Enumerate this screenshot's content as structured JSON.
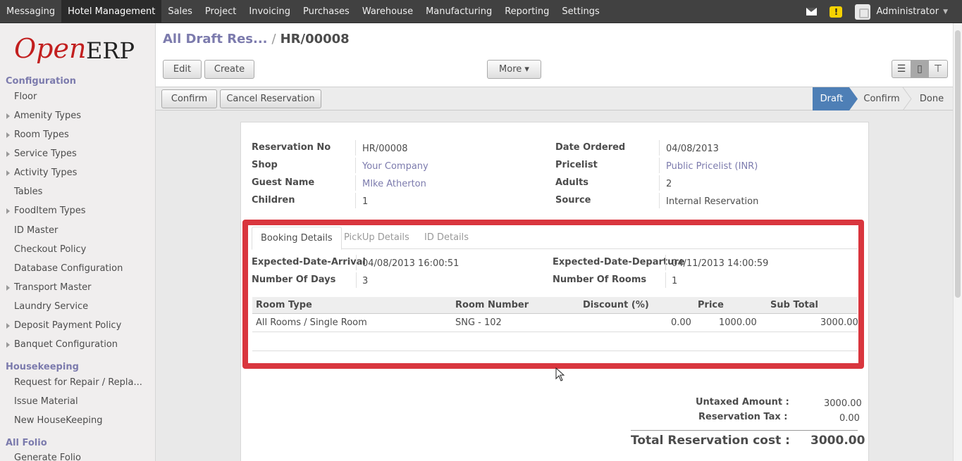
{
  "topbar": {
    "menu": [
      "Messaging",
      "Hotel Management",
      "Sales",
      "Project",
      "Invoicing",
      "Purchases",
      "Warehouse",
      "Manufacturing",
      "Reporting",
      "Settings"
    ],
    "active_menu": "Hotel Management",
    "user": "Administrator",
    "alert_glyph": "!"
  },
  "logo": {
    "open": "Open",
    "erp": "ERP"
  },
  "sidebar": {
    "sections": [
      {
        "title": "Configuration",
        "items": [
          {
            "label": "Floor",
            "expand": false
          },
          {
            "label": "Amenity Types",
            "expand": true
          },
          {
            "label": "Room Types",
            "expand": true
          },
          {
            "label": "Service Types",
            "expand": true
          },
          {
            "label": "Activity Types",
            "expand": true
          },
          {
            "label": "Tables",
            "expand": false
          },
          {
            "label": "FoodItem Types",
            "expand": true
          },
          {
            "label": "ID Master",
            "expand": false
          },
          {
            "label": "Checkout Policy",
            "expand": false
          },
          {
            "label": "Database Configuration",
            "expand": false
          },
          {
            "label": "Transport Master",
            "expand": true
          },
          {
            "label": "Laundry Service",
            "expand": false
          },
          {
            "label": "Deposit Payment Policy",
            "expand": true
          },
          {
            "label": "Banquet Configuration",
            "expand": true
          }
        ]
      },
      {
        "title": "Housekeeping",
        "items": [
          {
            "label": "Request for Repair / Repla...",
            "expand": false
          },
          {
            "label": "Issue Material",
            "expand": false
          },
          {
            "label": "New HouseKeeping",
            "expand": false
          }
        ]
      },
      {
        "title": "All Folio",
        "items": [
          {
            "label": "Generate Folio",
            "expand": false
          }
        ]
      }
    ]
  },
  "breadcrumb": {
    "parent": "All Draft Res...",
    "separator": "/",
    "current": "HR/00008"
  },
  "toolbar": {
    "edit": "Edit",
    "create": "Create",
    "more": "More ▾"
  },
  "view_icons": [
    "list-view-icon",
    "form-view-icon",
    "calendar-view-icon"
  ],
  "statusbar": {
    "confirm": "Confirm",
    "cancel": "Cancel Reservation",
    "stages": [
      "Draft",
      "Confirm",
      "Done"
    ],
    "active_stage": "Draft"
  },
  "form": {
    "reservation_no_label": "Reservation No",
    "reservation_no": "HR/00008",
    "shop_label": "Shop",
    "shop": "Your Company",
    "guest_label": "Guest Name",
    "guest": "MIke Atherton",
    "children_label": "Children",
    "children": "1",
    "date_ordered_label": "Date Ordered",
    "date_ordered": "04/08/2013",
    "pricelist_label": "Pricelist",
    "pricelist": "Public Pricelist (INR)",
    "adults_label": "Adults",
    "adults": "2",
    "source_label": "Source",
    "source": "Internal Reservation"
  },
  "tabs": [
    "Booking Details",
    "PickUp Details",
    "ID Details"
  ],
  "booking": {
    "arrival_label": "Expected-Date-Arrival",
    "arrival": "04/08/2013 16:00:51",
    "days_label": "Number Of Days",
    "days": "3",
    "departure_label": "Expected-Date-Departure",
    "departure": "04/11/2013 14:00:59",
    "rooms_label": "Number Of Rooms",
    "rooms": "1"
  },
  "grid": {
    "headers": [
      "Room Type",
      "Room Number",
      "Discount (%)",
      "Price",
      "Sub Total"
    ],
    "rows": [
      [
        "All Rooms / Single Room",
        "SNG - 102",
        "0.00",
        "1000.00",
        "3000.00"
      ]
    ]
  },
  "totals": {
    "untaxed_label": "Untaxed Amount :",
    "untaxed": "3000.00",
    "tax_label": "Reservation Tax :",
    "tax": "0.00",
    "total_label": "Total Reservation cost :",
    "total": "3000.00"
  },
  "colors": {
    "accent": "#7c7bad",
    "highlight": "#d9363e",
    "stage_active": "#4e7fb6"
  }
}
